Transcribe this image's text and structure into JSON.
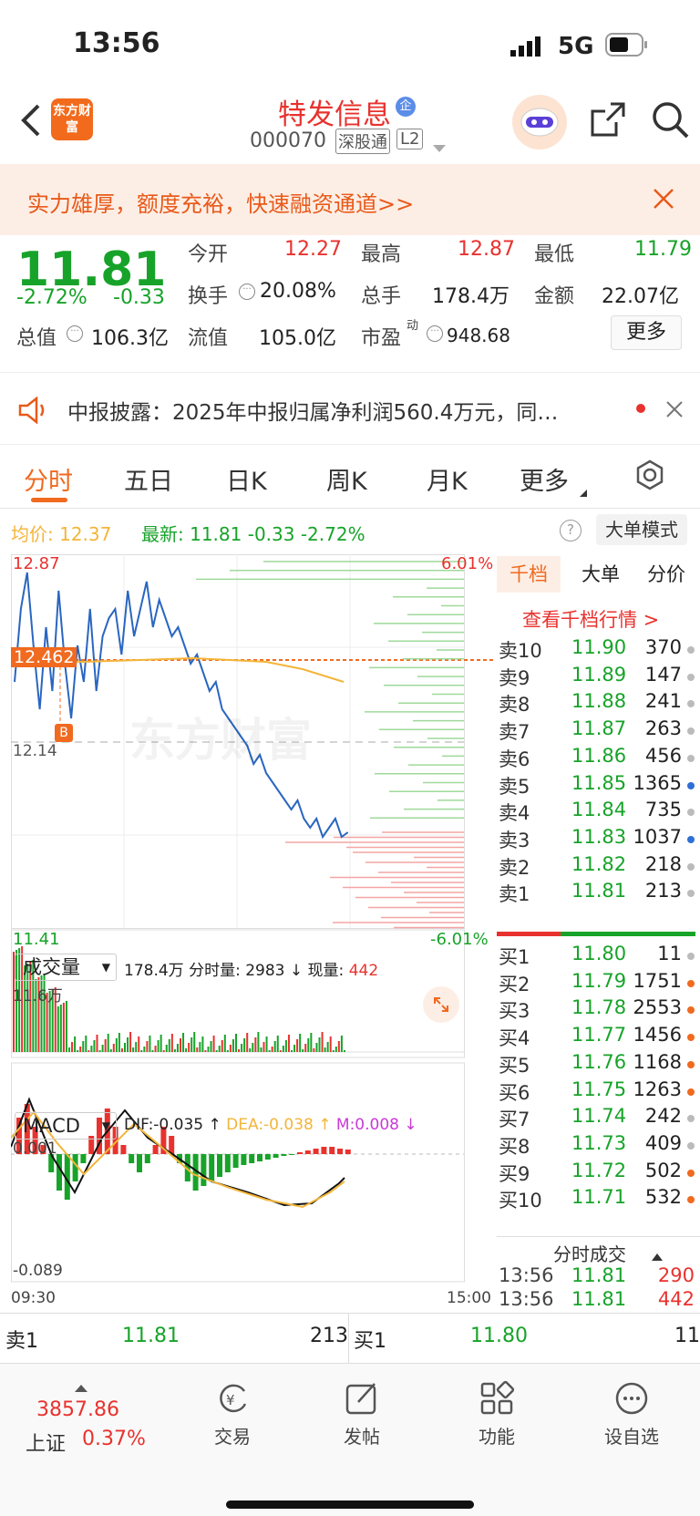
{
  "status": {
    "time": "13:56",
    "network": "5G"
  },
  "nav": {
    "title": "特发信息",
    "code": "000070",
    "market_tag": "深股通",
    "level_tag": "L2",
    "logo_text": "东方财富"
  },
  "promo": {
    "text": "实力雄厚，额度充裕，快速融资通道>>"
  },
  "quote": {
    "price": "11.81",
    "change_pct": "-2.72%",
    "change": "-0.33",
    "open_label": "今开",
    "open": "12.27",
    "high_label": "最高",
    "high": "12.87",
    "low_label": "最低",
    "low": "11.79",
    "turnover_label": "换手",
    "turnover": "20.08%",
    "volume_label": "总手",
    "volume": "178.4万",
    "amount_label": "金额",
    "amount": "22.07亿",
    "mktcap_label": "总值",
    "mktcap": "106.3亿",
    "float_label": "流值",
    "float": "105.0亿",
    "pe_label": "市盈",
    "pe_sup": "动",
    "pe": "948.68",
    "more": "更多"
  },
  "notice": {
    "text": "中报披露：2025年中报归属净利润560.4万元，同…"
  },
  "tabs": [
    "分时",
    "五日",
    "日K",
    "周K",
    "月K",
    "更多"
  ],
  "chart_info": {
    "avg_label": "均价:",
    "avg": "12.37",
    "latest_label": "最新:",
    "latest": "11.81",
    "chg": "-0.33",
    "pct": "-2.72%",
    "mode": "大单模式"
  },
  "price_axis": {
    "top": "12.87",
    "bottom": "11.41",
    "mid": "12.14",
    "top_pct": "6.01%",
    "bottom_pct": "-6.01%",
    "marker": "12.462",
    "buy_badge": "B",
    "watermark": "东方财富"
  },
  "volume_panel": {
    "label": "成交量",
    "total": "178.4万",
    "tick_label": "分时量:",
    "tick": "2983",
    "arrow": "↓",
    "now_label": "现量:",
    "now": "442",
    "max": "11.6万"
  },
  "macd": {
    "label": "MACD",
    "dif": "DIF:-0.035 ↑",
    "dea": "DEA:-0.038 ↑",
    "m": "M:0.008 ↓",
    "top": "0.001",
    "bottom": "-0.089"
  },
  "time_axis": {
    "start": "09:30",
    "end": "15:00"
  },
  "book": {
    "tabs": [
      "千档",
      "大单",
      "分价"
    ],
    "link": "查看千档行情 >",
    "asks": [
      {
        "label": "卖10",
        "price": "11.90",
        "vol": "370",
        "dot": "#bbbbbb"
      },
      {
        "label": "卖9",
        "price": "11.89",
        "vol": "147",
        "dot": "#bbbbbb"
      },
      {
        "label": "卖8",
        "price": "11.88",
        "vol": "241",
        "dot": "#bbbbbb"
      },
      {
        "label": "卖7",
        "price": "11.87",
        "vol": "263",
        "dot": "#bbbbbb"
      },
      {
        "label": "卖6",
        "price": "11.86",
        "vol": "456",
        "dot": "#bbbbbb"
      },
      {
        "label": "卖5",
        "price": "11.85",
        "vol": "1365",
        "dot": "#2f6fd6"
      },
      {
        "label": "卖4",
        "price": "11.84",
        "vol": "735",
        "dot": "#bbbbbb"
      },
      {
        "label": "卖3",
        "price": "11.83",
        "vol": "1037",
        "dot": "#2f6fd6"
      },
      {
        "label": "卖2",
        "price": "11.82",
        "vol": "218",
        "dot": "#bbbbbb"
      },
      {
        "label": "卖1",
        "price": "11.81",
        "vol": "213",
        "dot": "#bbbbbb"
      }
    ],
    "bids": [
      {
        "label": "买1",
        "price": "11.80",
        "vol": "11",
        "dot": "#bbbbbb"
      },
      {
        "label": "买2",
        "price": "11.79",
        "vol": "1751",
        "dot": "#f06a1f"
      },
      {
        "label": "买3",
        "price": "11.78",
        "vol": "2553",
        "dot": "#f06a1f"
      },
      {
        "label": "买4",
        "price": "11.77",
        "vol": "1456",
        "dot": "#f06a1f"
      },
      {
        "label": "买5",
        "price": "11.76",
        "vol": "1168",
        "dot": "#f06a1f"
      },
      {
        "label": "买6",
        "price": "11.75",
        "vol": "1263",
        "dot": "#f06a1f"
      },
      {
        "label": "买7",
        "price": "11.74",
        "vol": "242",
        "dot": "#bbbbbb"
      },
      {
        "label": "买8",
        "price": "11.73",
        "vol": "409",
        "dot": "#bbbbbb"
      },
      {
        "label": "买9",
        "price": "11.72",
        "vol": "502",
        "dot": "#f06a1f"
      },
      {
        "label": "买10",
        "price": "11.71",
        "vol": "532",
        "dot": "#f06a1f"
      }
    ],
    "trades_title": "分时成交",
    "trades": [
      {
        "time": "13:56",
        "price": "11.81",
        "vol": "290"
      },
      {
        "time": "13:56",
        "price": "11.81",
        "vol": "442"
      }
    ]
  },
  "bottom_quote": {
    "ask_label": "卖1",
    "ask_price": "11.81",
    "ask_vol": "213",
    "bid_label": "买1",
    "bid_price": "11.80",
    "bid_vol": "11"
  },
  "tabbar": {
    "index_value": "3857.86",
    "index_name": "上证",
    "index_pct": "0.37%",
    "items": [
      "交易",
      "发帖",
      "功能",
      "设自选"
    ]
  },
  "colors": {
    "up": "#e8322e",
    "down": "#17a329",
    "accent": "#f06a1f",
    "line": "#2a66c0",
    "avg": "#f3b53a"
  }
}
